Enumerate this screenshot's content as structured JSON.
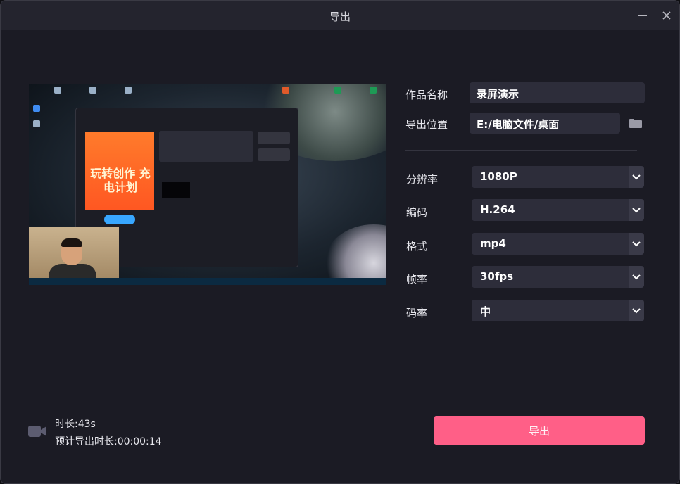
{
  "window": {
    "title": "导出",
    "minimize_icon": "minimize-icon",
    "close_icon": "close-icon"
  },
  "form": {
    "name_label": "作品名称",
    "name_value": "录屏演示",
    "location_label": "导出位置",
    "location_value": "E:/电脑文件/桌面",
    "folder_icon": "folder-icon",
    "selects": [
      {
        "label": "分辨率",
        "value": "1080P"
      },
      {
        "label": "编码",
        "value": "H.264"
      },
      {
        "label": "格式",
        "value": "mp4"
      },
      {
        "label": "帧率",
        "value": "30fps"
      },
      {
        "label": "码率",
        "value": "中"
      }
    ]
  },
  "footer": {
    "camera_icon": "video-camera-icon",
    "duration": "时长:43s",
    "estimated": "预计导出时长:00:00:14",
    "export_label": "导出"
  },
  "preview": {
    "banner_text": "玩转创作 充电计划"
  },
  "colors": {
    "window_bg": "#1b1b24",
    "field_bg": "#2d2d3a",
    "accent": "#ff5f87"
  }
}
